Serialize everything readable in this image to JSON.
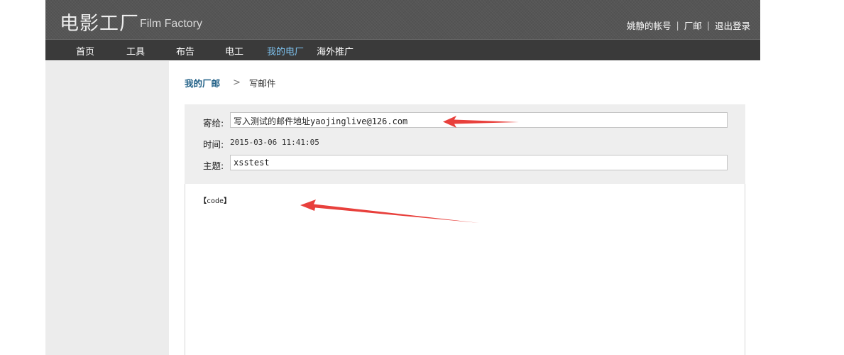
{
  "header": {
    "logo_cn": "电影工厂",
    "logo_en": "Film Factory",
    "user_links": [
      "姚静的帐号",
      "厂邮",
      "退出登录"
    ]
  },
  "nav": {
    "items": [
      "首页",
      "工具",
      "布告",
      "电工",
      "我的电厂",
      "海外推广"
    ],
    "active_index": 4
  },
  "breadcrumb": {
    "parent": "我的厂邮",
    "separator": ">",
    "current": "写邮件"
  },
  "compose": {
    "to_label": "寄给:",
    "to_value_cn": "写入测试的邮件地址",
    "to_value_email": "yaojinglive@126.com",
    "time_label": "时间:",
    "time_value": "2015-03-06 11:41:05",
    "subject_label": "主题:",
    "subject_value": "xsstest",
    "body_open": "【",
    "body_text": "code",
    "body_close": "】"
  },
  "colors": {
    "header_bg": "#555555",
    "nav_bg": "#3a3a3a",
    "nav_active": "#7ec3f0",
    "breadcrumb_link": "#1f5f86",
    "sidebar_bg": "#ececec",
    "form_bg": "#eeeeee",
    "annotation_arrow": "#e8403c"
  }
}
